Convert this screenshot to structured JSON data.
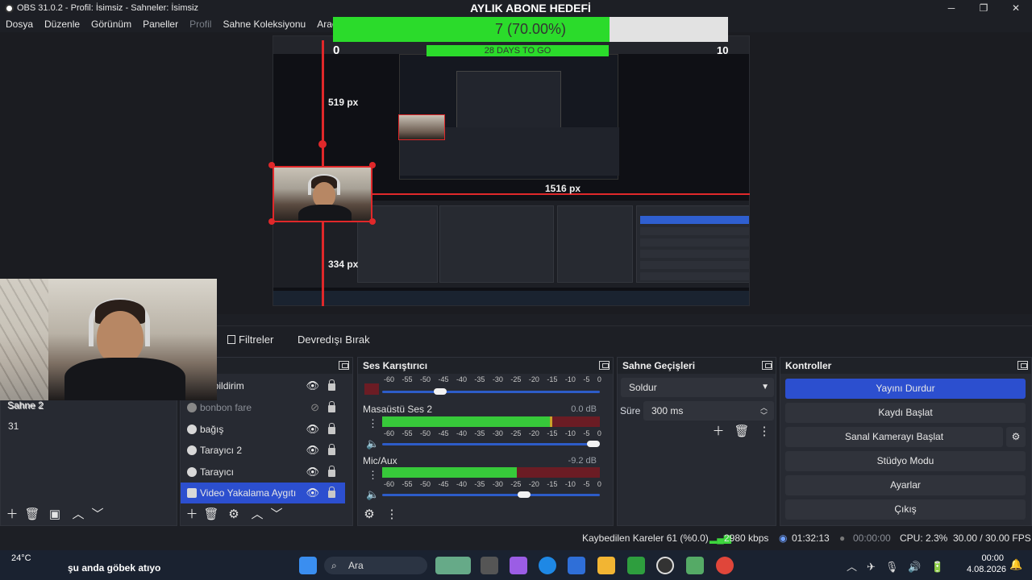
{
  "window": {
    "title": "OBS 31.0.2 - Profil: İsimsiz - Sahneler: İsimsiz",
    "minimize": "─",
    "maximize": "❐",
    "close": "✕"
  },
  "menu": {
    "items": [
      "Dosya",
      "Düzenle",
      "Görünüm",
      "Paneller",
      "Profil",
      "Sahne Koleksiyonu",
      "Araçlar"
    ]
  },
  "goal": {
    "title": "AYLIK ABONE HEDEFİ",
    "progress_text": "7 (70.00%)",
    "progress": 0.7,
    "days_text": "28 DAYS TO GO",
    "min": "0",
    "max": "10"
  },
  "preview": {
    "label_top": "519 px",
    "label_right": "1516 px",
    "label_bottom": "334 px"
  },
  "context_bar": {
    "filters": "Filtreler",
    "deactivate": "Devredışı Bırak"
  },
  "scenes": {
    "items": [
      "Sahne 2",
      "31"
    ]
  },
  "sources": {
    "title": "lar",
    "items": [
      {
        "label": "ne bildirim",
        "visible": true
      },
      {
        "label": "bonbon fare",
        "visible": false
      },
      {
        "label": "bağış",
        "visible": true
      },
      {
        "label": "Tarayıcı 2",
        "visible": true
      },
      {
        "label": "Tarayıcı",
        "visible": true
      },
      {
        "label": "Video Yakalama Aygıtı",
        "visible": true
      }
    ]
  },
  "mixer": {
    "title": "Ses Karıştırıcı",
    "scale": [
      "-60",
      "-55",
      "-50",
      "-45",
      "-40",
      "-35",
      "-30",
      "-25",
      "-20",
      "-15",
      "-10",
      "-5",
      "0"
    ],
    "channels": [
      {
        "name": "Masaüstü Ses 2",
        "db": "0.0 dB",
        "level": 0.78,
        "volume": 1.0
      },
      {
        "name": "Mic/Aux",
        "db": "-9.2 dB",
        "level": 0.62,
        "volume": 0.68
      }
    ]
  },
  "transitions": {
    "title": "Sahne Geçişleri",
    "selected": "Soldur",
    "duration_label": "Süre",
    "duration": "300 ms"
  },
  "controls": {
    "title": "Kontroller",
    "stop_stream": "Yayını Durdur",
    "start_record": "Kaydı Başlat",
    "virtual_cam": "Sanal Kamerayı Başlat",
    "studio_mode": "Stüdyo Modu",
    "settings": "Ayarlar",
    "exit": "Çıkış"
  },
  "status": {
    "dropped": "Kaybedilen Kareler 61 (%0.0)",
    "bitrate": "2980 kbps",
    "stream_time": "01:32:13",
    "record_time": "00:00:00",
    "cpu": "CPU: 2.3%",
    "fps": "30.00 / 30.00 FPS"
  },
  "taskbar": {
    "weather_temp": "24°C",
    "ticker": "şu anda göbek atıyo",
    "search": "Ara",
    "time": "00:00",
    "date": "4.08.2026"
  },
  "colors": {
    "accent": "#2c4fcf",
    "red_outline": "#e0282a",
    "goal_green": "#2bdb2b"
  }
}
